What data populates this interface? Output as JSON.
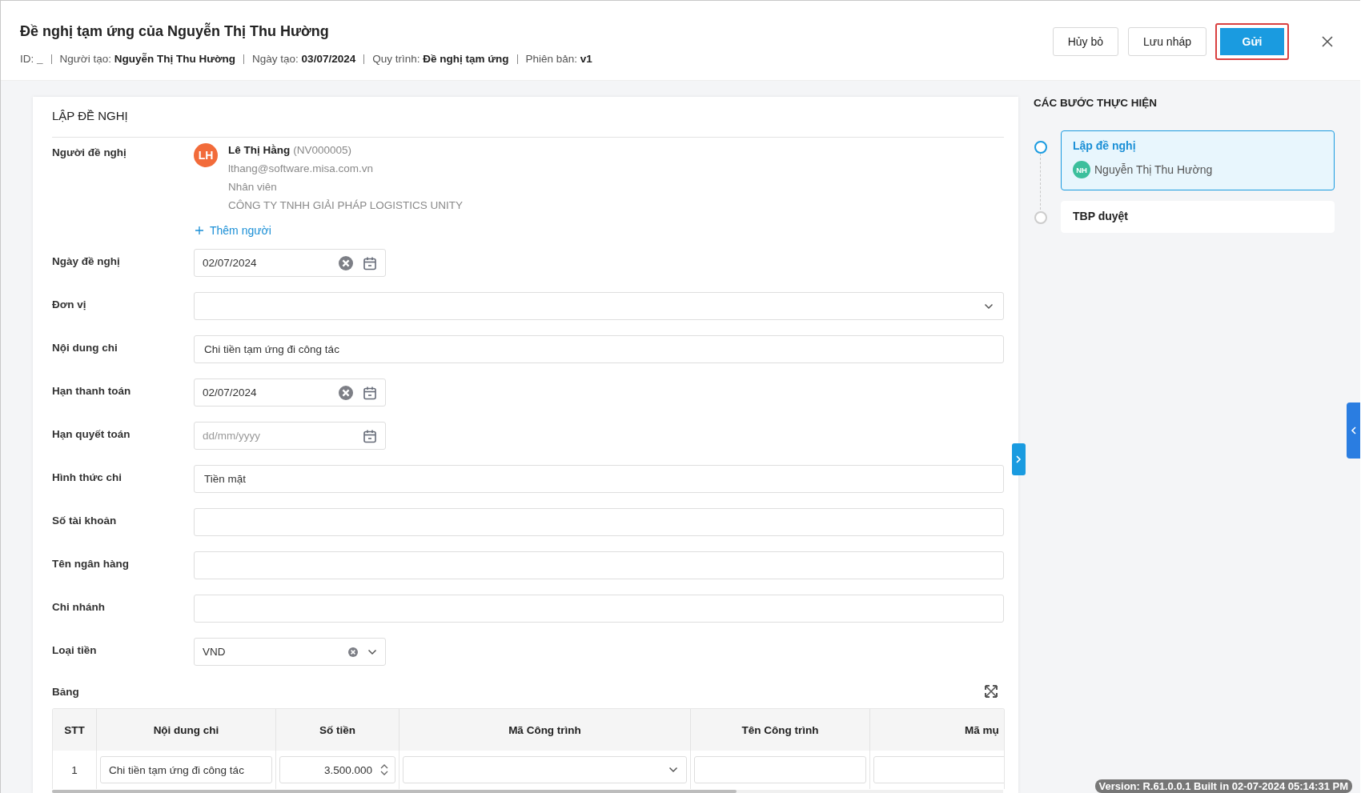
{
  "header": {
    "title": "Đề nghị tạm ứng của Nguyễn Thị Thu Hường",
    "meta": [
      "ID: **_**",
      "Người tạo: **Nguyễn Thị Thu Hường**",
      "Ngày tạo: **03/07/2024**",
      "Quy trình: **Đề nghị tạm ứng**",
      "Phiên bản: **v1**"
    ],
    "buttons": [
      {
        "label": "Hủy bỏ",
        "kind": "secondary",
        "focused": false
      },
      {
        "label": "Lưu nháp",
        "kind": "secondary",
        "focused": false
      },
      {
        "label": "Gửi",
        "kind": "primary",
        "focused": true
      }
    ]
  },
  "form": {
    "title": "LẬP ĐỀ NGHỊ",
    "requester": {
      "label": "Người đề nghị",
      "initials": "LH",
      "name": "Lê Thị Hằng",
      "code": "(NV000005)",
      "email": "lthang@software.misa.com.vn",
      "role": "Nhân viên",
      "company": "CÔNG TY TNHH GIẢI PHÁP LOGISTICS UNITY",
      "add_link": "Thêm người"
    },
    "fields": [
      {
        "label": "Ngày đề nghị",
        "kind": "date",
        "value": "02/07/2024"
      },
      {
        "label": "Đơn vị",
        "kind": "select"
      },
      {
        "label": "Nội dung chi",
        "kind": "text",
        "value": "Chi tiền tạm ứng đi công tác"
      },
      {
        "label": "Hạn thanh toán",
        "kind": "date",
        "value": "02/07/2024"
      },
      {
        "label": "Hạn quyết toán",
        "kind": "date",
        "placeholder": "dd/mm/yyyy"
      },
      {
        "label": "Hình thức chi",
        "kind": "text",
        "value": "Tiền mặt"
      },
      {
        "label": "Số tài khoản",
        "kind": "text"
      },
      {
        "label": "Tên ngân hàng",
        "kind": "text"
      },
      {
        "label": "Chi nhánh",
        "kind": "text"
      },
      {
        "label": "Loại tiền",
        "kind": "combo",
        "value": "VND"
      }
    ],
    "table": {
      "label": "Bảng",
      "columns": [
        "STT",
        "Nội dung chi",
        "Số tiền",
        "Mã Công trình",
        "Tên Công trình",
        "Mã mụ"
      ],
      "rows": [
        {
          "cells": [
            {
              "kind": "plain",
              "value": "1"
            },
            {
              "kind": "text",
              "value": "Chi tiền tạm ứng đi công tác"
            },
            {
              "kind": "spin",
              "value": "3.500.000"
            },
            {
              "kind": "select"
            },
            {
              "kind": "text"
            },
            {
              "kind": "text"
            }
          ]
        }
      ]
    }
  },
  "steps": {
    "title": "CÁC BƯỚC THỰC HIỆN",
    "items": [
      {
        "name": "Lập đề nghị",
        "selected": true,
        "assignee": {
          "initials": "NH",
          "name": "Nguyễn Thị Thu Hường"
        }
      },
      {
        "name": "TBP duyệt",
        "selected": false
      }
    ]
  },
  "version": "Version: R.61.0.0.1 Built in 02-07-2024 05:14:31 PM"
}
